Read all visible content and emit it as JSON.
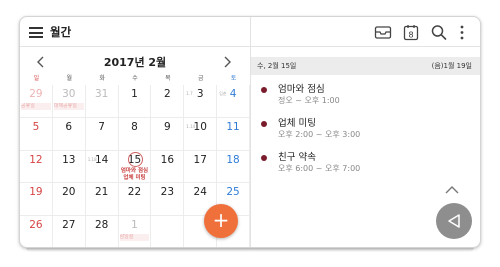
{
  "app": {
    "title": "월간"
  },
  "toolbar": {
    "today_day": "8"
  },
  "calendar": {
    "month_title": "2017년 2월",
    "weekdays": [
      "일",
      "월",
      "화",
      "수",
      "목",
      "금",
      "토"
    ],
    "weeks": [
      [
        {
          "day": "29",
          "dim": true,
          "event": "공휴일",
          "faint": true
        },
        {
          "day": "30",
          "dim": true,
          "event": "대체공휴일",
          "faint": true
        },
        {
          "day": "31",
          "dim": true
        },
        {
          "day": "1"
        },
        {
          "day": "2"
        },
        {
          "day": "3",
          "lunar": "1.7"
        },
        {
          "day": "4",
          "lunar": "입춘"
        }
      ],
      [
        {
          "day": "5"
        },
        {
          "day": "6"
        },
        {
          "day": "7"
        },
        {
          "day": "8"
        },
        {
          "day": "9"
        },
        {
          "day": "10",
          "lunar": "1.14"
        },
        {
          "day": "11"
        }
      ],
      [
        {
          "day": "12"
        },
        {
          "day": "13"
        },
        {
          "day": "14",
          "lunar": "1.18"
        },
        {
          "day": "15",
          "today": true,
          "mini": [
            "엄마와 점심",
            "업체 미팅"
          ]
        },
        {
          "day": "16"
        },
        {
          "day": "17"
        },
        {
          "day": "18"
        }
      ],
      [
        {
          "day": "19"
        },
        {
          "day": "20"
        },
        {
          "day": "21"
        },
        {
          "day": "22"
        },
        {
          "day": "23"
        },
        {
          "day": "24"
        },
        {
          "day": "25"
        }
      ],
      [
        {
          "day": "26"
        },
        {
          "day": "27"
        },
        {
          "day": "28"
        },
        {
          "day": "1",
          "dim": true,
          "event": "삼일절",
          "faint": true
        },
        {
          "day": "",
          "dim": true
        },
        {
          "day": "",
          "dim": true
        },
        {
          "day": "",
          "dim": true
        }
      ]
    ]
  },
  "agenda": {
    "date_label": "수, 2월 15일",
    "lunar_label": "(음)1월 19일",
    "events": [
      {
        "title": "엄마와 점심",
        "time": "정오 ~ 오후 1:00"
      },
      {
        "title": "업체 미팅",
        "time": "오후 2:00 ~ 오후 3:00"
      },
      {
        "title": "친구 약속",
        "time": "오후 6:00 ~ 오후 7:00"
      }
    ]
  },
  "fab": {
    "label": "+"
  },
  "colors": {
    "accent": "#f0703c",
    "sunday": "#d64545",
    "saturday": "#2f7cd8",
    "event_dot": "#7a1c2c",
    "today_ring": "#d06060"
  },
  "icons": [
    "menu-icon",
    "inbox-icon",
    "calendar-today-icon",
    "search-icon",
    "more-vert-icon",
    "chevron-left-icon",
    "chevron-right-icon",
    "chevron-up-icon",
    "back-icon"
  ]
}
